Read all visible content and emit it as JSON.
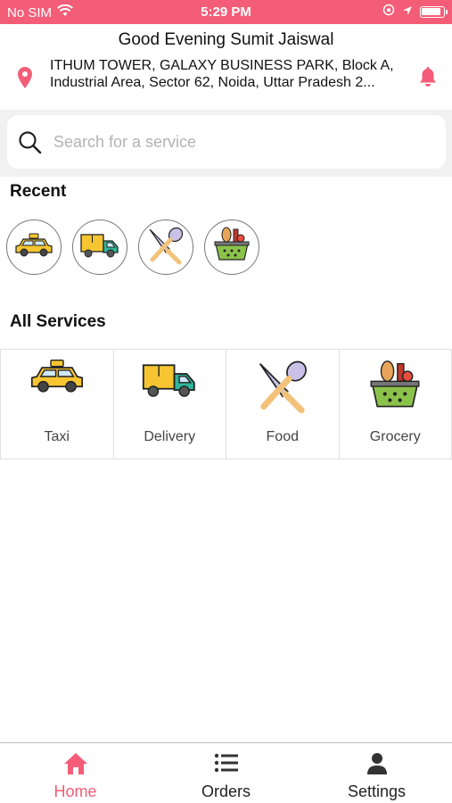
{
  "status_bar": {
    "carrier": "No SIM",
    "time": "5:29 PM",
    "battery_level": 0.9
  },
  "header": {
    "greeting": "Good Evening Sumit Jaiswal",
    "address_line1": "ITHUM TOWER, GALAXY BUSINESS PARK, Block A,",
    "address_line2": "Industrial Area, Sector 62, Noida, Uttar Pradesh 2..."
  },
  "search": {
    "placeholder": "Search for a service"
  },
  "recent": {
    "title": "Recent",
    "items": [
      "taxi-icon",
      "delivery-truck-icon",
      "food-icon",
      "grocery-basket-icon"
    ]
  },
  "services": {
    "title": "All Services",
    "items": [
      {
        "label": "Taxi",
        "icon": "taxi-icon"
      },
      {
        "label": "Delivery",
        "icon": "delivery-truck-icon"
      },
      {
        "label": "Food",
        "icon": "food-icon"
      },
      {
        "label": "Grocery",
        "icon": "grocery-basket-icon"
      }
    ]
  },
  "tabbar": {
    "tabs": [
      {
        "label": "Home",
        "icon": "home-icon",
        "active": true
      },
      {
        "label": "Orders",
        "icon": "list-icon",
        "active": false
      },
      {
        "label": "Settings",
        "icon": "person-icon",
        "active": false
      }
    ]
  },
  "colors": {
    "accent": "#f35d77",
    "taxi_yellow": "#f6c531",
    "truck_green": "#2fb59a",
    "basket_green": "#8bc34a"
  }
}
